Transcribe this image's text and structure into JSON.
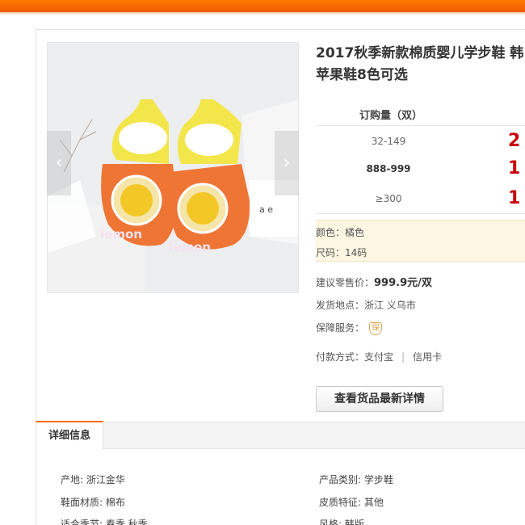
{
  "product": {
    "title_line1": "2017秋季新款棉质婴儿学步鞋 韩",
    "title_line2": "苹果鞋8色可选",
    "image_alt": "lemon"
  },
  "pricing": {
    "header": "订购量（双）",
    "tiers": [
      {
        "qty": "32-149",
        "price": "2"
      },
      {
        "qty": "888-999",
        "price": "1"
      },
      {
        "qty": "≥300",
        "price": "1"
      }
    ]
  },
  "specs": {
    "color": "颜色：橘色",
    "size": "尺码：14码"
  },
  "info": {
    "retail_label": "建议零售价：",
    "retail_value": "999.9元/双",
    "ship_label": "发货地点：",
    "ship_value": "浙江 义乌市",
    "guarantee_label": "保障服务：",
    "guarantee_icon_text": "保",
    "payment_label": "付款方式：",
    "payment_option1": "支付宝",
    "payment_sep": "|",
    "payment_option2": "信用卡"
  },
  "detail_button": "查看货品最新详情",
  "tabs": {
    "details": "详细信息"
  },
  "attributes": {
    "origin": "产地: 浙江金华",
    "category": "产品类别: 学步鞋",
    "upper": "鞋面材质: 棉布",
    "leather": "皮质特征: 其他",
    "season": "适合季节: 春季 秋季",
    "style": "风格: 韩版"
  },
  "icons": {
    "prev": "chevron-left-icon",
    "next": "chevron-right-icon",
    "guarantee": "guarantee-shield-icon"
  },
  "colors": {
    "accent": "#ff6a00",
    "price": "#c8000a",
    "spec_bg": "#fdf6e3"
  }
}
